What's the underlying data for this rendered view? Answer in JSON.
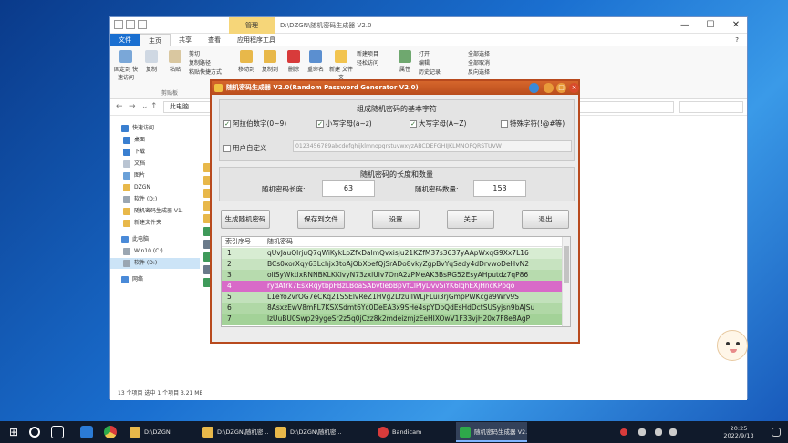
{
  "explorer": {
    "title": "D:\\DZGN\\随机密码生成器 V2.0",
    "context_tab": "管理",
    "tabs": [
      "文件",
      "主页",
      "共享",
      "查看",
      "应用程序工具"
    ],
    "ribbon": {
      "pin": "固定到\n快速访问",
      "copy": "复制",
      "paste": "粘贴",
      "cut": "剪切",
      "copy_path": "复制路径",
      "paste_shortcut": "粘贴快捷方式",
      "move_to": "移动到",
      "copy_to": "复制到",
      "delete": "删除",
      "rename": "重命名",
      "new_folder": "新建\n文件夹",
      "new_item": "新建项目",
      "easy_access": "轻松访问",
      "properties": "属性",
      "open": "打开",
      "edit": "编辑",
      "history": "历史记录",
      "select_all": "全部选择",
      "select_none": "全部取消",
      "invert": "反向选择",
      "clipboard_group": "剪贴板"
    },
    "address": "此电脑",
    "nav": [
      {
        "label": "快速访问",
        "level": 0
      },
      {
        "label": "桌面",
        "level": 1
      },
      {
        "label": "下载",
        "level": 1
      },
      {
        "label": "文档",
        "level": 1
      },
      {
        "label": "图片",
        "level": 1
      },
      {
        "label": "DZGN",
        "level": 1
      },
      {
        "label": "软件 (D:)",
        "level": 1
      },
      {
        "label": "随机密码生成器 V1.",
        "level": 1
      },
      {
        "label": "新建文件夹",
        "level": 1
      },
      {
        "label": "此电脑",
        "level": 0
      },
      {
        "label": "Win10 (C:)",
        "level": 1
      },
      {
        "label": "软件 (D:)",
        "level": 1,
        "selected": true
      },
      {
        "label": "网络",
        "level": 0
      }
    ],
    "status": "13 个项目    选中 1 个项目  3.21 MB"
  },
  "gen": {
    "title": "随机密码生成器 V2.0(Random Password Generator V2.0)",
    "section1": "组成随机密码的基本字符",
    "checks": [
      {
        "label": "阿拉伯数字(0~9)",
        "checked": true
      },
      {
        "label": "小写字母(a~z)",
        "checked": true
      },
      {
        "label": "大写字母(A~Z)",
        "checked": true
      },
      {
        "label": "特殊字符(!@#等)",
        "checked": false
      }
    ],
    "custom_label": "用户自定义",
    "charset": "0123456789abcdefghijklmnopqrstuvwxyzABCDEFGHIJKLMNOPQRSTUVW",
    "section2": "随机密码的长度和数量",
    "len_label": "随机密码长度:",
    "len_value": "63",
    "count_label": "随机密码数量:",
    "count_value": "153",
    "buttons": [
      "生成随机密码",
      "保存到文件",
      "设置",
      "关于",
      "退出"
    ],
    "table": {
      "col_index": "索引序号",
      "col_pw": "随机密码",
      "rows": [
        {
          "i": "1",
          "pw": "qUvJauQlrjuQ7qWiKykLpZfxDalmQvxisju21KZfM37s3637yAApWxqG9Xx7L16"
        },
        {
          "i": "2",
          "pw": "BCs0xorXqy63Lchjx3toAjObXoefQjSrADo8vkyZgpBvYqSady4dDrvwoDeHvN2"
        },
        {
          "i": "3",
          "pw": "oliSyWktlxRNNBKLKKlvyN73zxlUlv7OnA2zPMeAK3BsRG52EsyAHputdz7qP86"
        },
        {
          "i": "4",
          "pw": "rydAtrk7EsxRqytbpFBzLBoaSAbvtlebBpVfClPlyDvvSiYK6lqhEXjHncKPpqo"
        },
        {
          "i": "5",
          "pw": "L1eYo2vrOG7eCKq21SSElvReZ1HVg2LfzuIIWLjFLui3rjGmpPWKcga9Wrv9S"
        },
        {
          "i": "6",
          "pw": "8AsxzEwV8mFL7KSXSdmt6Yc0DeEA3x9SHe4spYDpQdEsHdDctSUSyjsn9bAJSu"
        },
        {
          "i": "7",
          "pw": "lzUuBU0Swp29ygeSr2z5q0jCzz8k2mdeizmjzEeHIXOwV1F33vjH20x7F8e8AgP"
        }
      ]
    }
  },
  "taskbar": {
    "items": [
      {
        "label": "D:\\DZGN",
        "color": "#e8b84a"
      },
      {
        "label": "D:\\DZGN\\随机密...",
        "color": "#e8b84a"
      },
      {
        "label": "D:\\DZGN\\随机密...",
        "color": "#e8b84a"
      },
      {
        "label": "Bandicam",
        "color": "#d83b3b"
      },
      {
        "label": "随机密码生成器 V2...",
        "color": "#2ea84a",
        "active": true
      }
    ],
    "time": "20:25",
    "date": "2022/9/13"
  }
}
